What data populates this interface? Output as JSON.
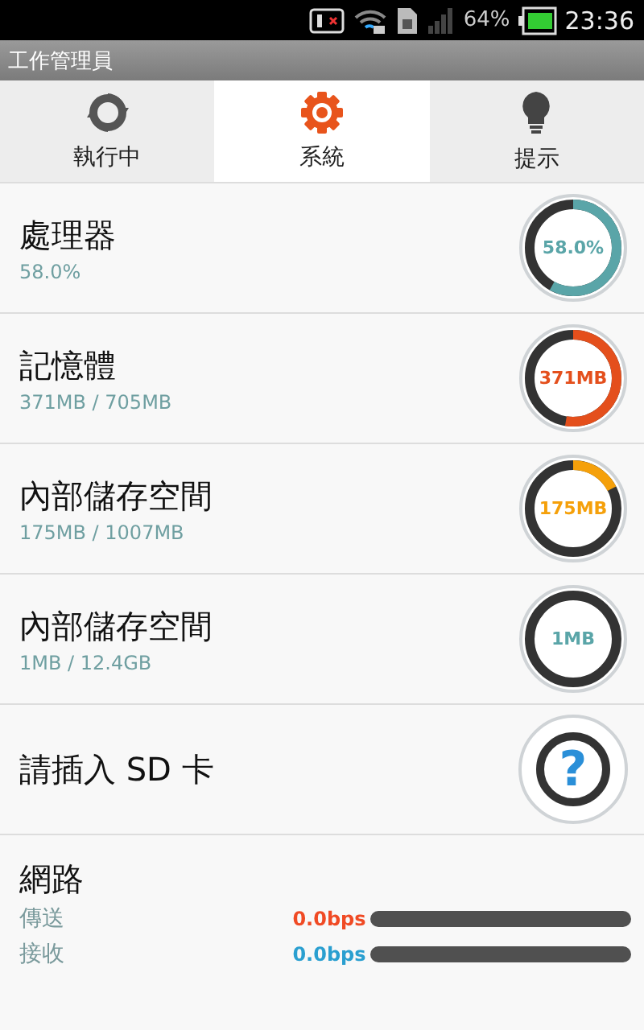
{
  "status_bar": {
    "battery": "64%",
    "time": "23:36"
  },
  "app_title": "工作管理員",
  "tabs": [
    {
      "label": "執行中",
      "kind": "sync",
      "selected": false
    },
    {
      "label": "系統",
      "kind": "gear",
      "selected": true
    },
    {
      "label": "提示",
      "kind": "bulb",
      "selected": false
    }
  ],
  "items": [
    {
      "kind": "gauge",
      "title": "處理器",
      "detail": "58.0%",
      "reading": "58.0%",
      "level": 0.58,
      "color": "#5aa5a8"
    },
    {
      "kind": "gauge",
      "title": "記憶體",
      "detail": "371MB / 705MB",
      "reading": "371MB",
      "level": 0.526,
      "color": "#e44f1c"
    },
    {
      "kind": "gauge",
      "title": "內部儲存空間",
      "detail": "175MB / 1007MB",
      "reading": "175MB",
      "level": 0.174,
      "color": "#f5a00a"
    },
    {
      "kind": "gauge",
      "title": "內部儲存空間",
      "detail": "1MB / 12.4GB",
      "reading": "1MB",
      "level": 0,
      "color": "#5aa5a8"
    },
    {
      "kind": "question",
      "title": "請插入 SD 卡",
      "symbol": "?"
    }
  ],
  "network": {
    "title": "網路",
    "rows": [
      {
        "label": "傳送",
        "rate": "0.0bps",
        "color": "#f04a24"
      },
      {
        "label": "接收",
        "rate": "0.0bps",
        "color": "#2a9fd0"
      }
    ]
  }
}
